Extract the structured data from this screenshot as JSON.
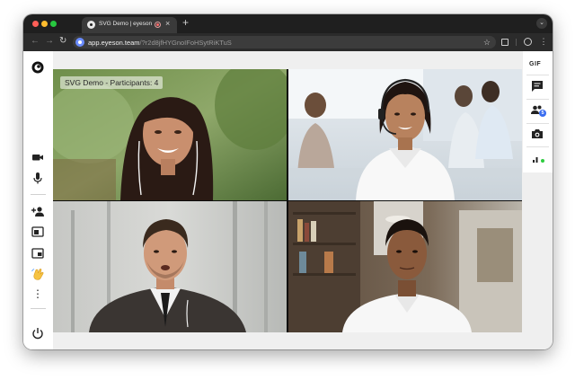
{
  "browser": {
    "tab_title": "SVG Demo | eyeson",
    "tab_close": "×",
    "new_tab": "+",
    "tab_menu": "⌄",
    "nav_back": "←",
    "nav_forward": "→",
    "nav_reload": "↻",
    "url_host": "app.eyeson.team",
    "url_path": "/?r2d8jfHYGnoIFoHSytRiKTuS",
    "bookmark_star": "☆",
    "menu_kebab": "⋮"
  },
  "app": {
    "overlay_text": "SVG Demo - Participants: 4",
    "right_sidebar": {
      "gif_label": "GIF",
      "participants_badge": "5"
    },
    "left_sidebar": {
      "more_label": "⋮"
    },
    "participants": [
      "participant-1",
      "participant-2",
      "participant-3",
      "participant-4"
    ],
    "colors": {
      "accent": "#3a6df0",
      "status_green": "#2ecc40",
      "sidebar_bg": "#ffffff",
      "app_bg": "#efefef"
    },
    "icons": {
      "left": [
        "eyeson-logo-icon",
        "camera-icon",
        "microphone-icon",
        "add-user-icon",
        "screen-share-icon",
        "presentation-icon",
        "wave-hand-icon",
        "more-icon",
        "power-icon"
      ],
      "right": [
        "gif-icon",
        "chat-icon",
        "participants-icon",
        "snapshot-camera-icon",
        "stats-icon"
      ]
    }
  }
}
